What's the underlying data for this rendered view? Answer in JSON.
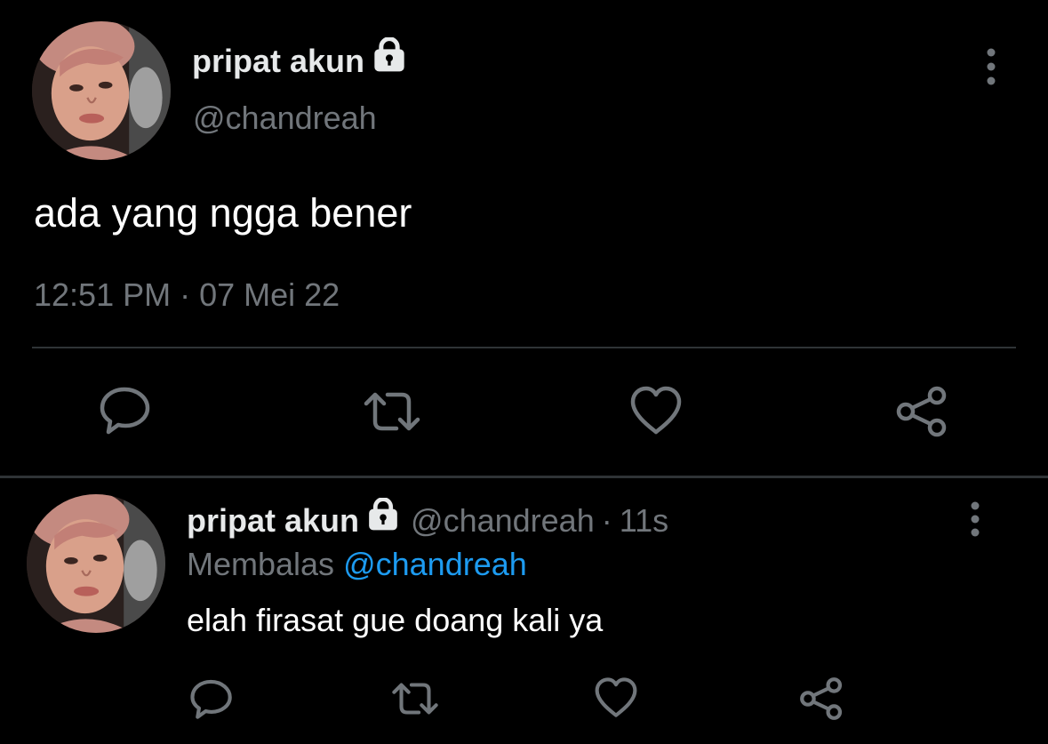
{
  "tweet": {
    "display_name": "pripat akun",
    "handle": "@chandreah",
    "text": "ada yang ngga bener",
    "timestamp": "12:51 PM · 07 Mei 22",
    "avatar_icon": "profile-photo",
    "lock_icon": "lock-icon",
    "more_icon": "more-vertical-icon",
    "actions": [
      "reply-icon",
      "retweet-icon",
      "like-icon",
      "share-icon"
    ]
  },
  "reply": {
    "display_name": "pripat akun",
    "handle": "@chandreah",
    "separator": "·",
    "time_ago": "11s",
    "replying_label": "Membalas",
    "replying_mention": "@chandreah",
    "text": "elah firasat gue doang kali ya",
    "avatar_icon": "profile-photo",
    "lock_icon": "lock-icon",
    "more_icon": "more-vertical-icon",
    "actions": [
      "reply-icon",
      "retweet-icon",
      "like-icon",
      "share-icon"
    ]
  },
  "colors": {
    "background": "#000000",
    "primary_text": "#e7e9ea",
    "secondary_text": "#71767b",
    "link": "#1d9bf0",
    "divider": "#2f3336",
    "icon": "#71767b"
  }
}
